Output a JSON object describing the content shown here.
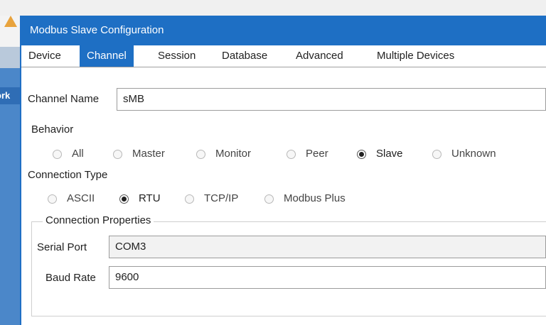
{
  "window": {
    "title": "Modbus Slave Configuration"
  },
  "left_panel": {
    "label": "ork"
  },
  "tabs": [
    {
      "label": "Device",
      "active": false
    },
    {
      "label": "Channel",
      "active": true
    },
    {
      "label": "Session",
      "active": false
    },
    {
      "label": "Database",
      "active": false
    },
    {
      "label": "Advanced",
      "active": false
    },
    {
      "label": "Multiple Devices",
      "active": false
    }
  ],
  "channel": {
    "name_label": "Channel Name",
    "name_value": "sMB"
  },
  "behavior": {
    "label": "Behavior",
    "options": [
      {
        "label": "All",
        "checked": false
      },
      {
        "label": "Master",
        "checked": false
      },
      {
        "label": "Monitor",
        "checked": false
      },
      {
        "label": "Peer",
        "checked": false
      },
      {
        "label": "Slave",
        "checked": true
      },
      {
        "label": "Unknown",
        "checked": false
      }
    ]
  },
  "connection_type": {
    "label": "Connection Type",
    "options": [
      {
        "label": "ASCII",
        "checked": false
      },
      {
        "label": "RTU",
        "checked": true
      },
      {
        "label": "TCP/IP",
        "checked": false
      },
      {
        "label": "Modbus Plus",
        "checked": false
      }
    ]
  },
  "connection_properties": {
    "title": "Connection Properties",
    "serial_port_label": "Serial Port",
    "serial_port_value": "COM3",
    "baud_rate_label": "Baud Rate",
    "baud_rate_value": "9600"
  },
  "colors": {
    "accent": "#1e6fc4",
    "warning": "#e8a33d"
  }
}
